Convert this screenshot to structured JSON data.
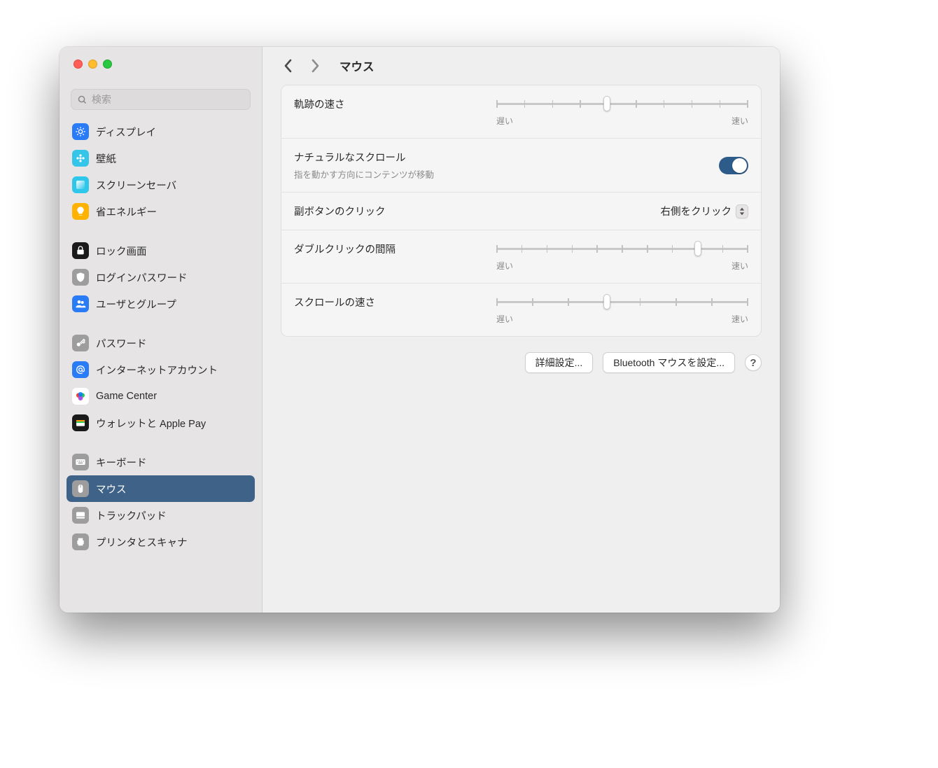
{
  "search": {
    "placeholder": "検索"
  },
  "sidebar": {
    "groups": [
      {
        "items": [
          {
            "id": "display",
            "label": "ディスプレイ",
            "icon": "brightness-icon",
            "bg": "#2a7bf6",
            "fg": "#fff"
          },
          {
            "id": "wallpaper",
            "label": "壁紙",
            "icon": "flower-icon",
            "bg": "#35c5e8",
            "fg": "#fff"
          },
          {
            "id": "screensaver",
            "label": "スクリーンセーバ",
            "icon": "gradient-icon",
            "bg": "#2ec7ea",
            "fg": "#fff"
          },
          {
            "id": "energy",
            "label": "省エネルギー",
            "icon": "bulb-icon",
            "bg": "#ffb300",
            "fg": "#fff"
          }
        ]
      },
      {
        "items": [
          {
            "id": "lockscreen",
            "label": "ロック画面",
            "icon": "lock-icon",
            "bg": "#1a1a1a",
            "fg": "#fff"
          },
          {
            "id": "loginpassword",
            "label": "ログインパスワード",
            "icon": "shield-icon",
            "bg": "#9d9d9d",
            "fg": "#fff"
          },
          {
            "id": "users",
            "label": "ユーザとグループ",
            "icon": "users-icon",
            "bg": "#2a7bf6",
            "fg": "#fff"
          }
        ]
      },
      {
        "items": [
          {
            "id": "passwords",
            "label": "パスワード",
            "icon": "key-icon",
            "bg": "#9d9d9d",
            "fg": "#fff"
          },
          {
            "id": "internet-accounts",
            "label": "インターネットアカウント",
            "icon": "at-icon",
            "bg": "#2a7bf6",
            "fg": "#fff"
          },
          {
            "id": "gamecenter",
            "label": "Game Center",
            "icon": "gamecenter-icon",
            "bg": "#ffffff",
            "fg": "#000"
          },
          {
            "id": "wallet",
            "label": "ウォレットと Apple Pay",
            "icon": "wallet-icon",
            "bg": "#1a1a1a",
            "fg": "#fff"
          }
        ]
      },
      {
        "items": [
          {
            "id": "keyboard",
            "label": "キーボード",
            "icon": "keyboard-icon",
            "bg": "#9d9d9d",
            "fg": "#fff"
          },
          {
            "id": "mouse",
            "label": "マウス",
            "icon": "mouse-icon",
            "bg": "#9d9d9d",
            "fg": "#fff",
            "selected": true
          },
          {
            "id": "trackpad",
            "label": "トラックパッド",
            "icon": "trackpad-icon",
            "bg": "#9d9d9d",
            "fg": "#fff"
          },
          {
            "id": "printers",
            "label": "プリンタとスキャナ",
            "icon": "printer-icon",
            "bg": "#9d9d9d",
            "fg": "#fff"
          }
        ]
      }
    ]
  },
  "header": {
    "title": "マウス"
  },
  "settings": {
    "tracking": {
      "label": "軌跡の速さ",
      "min_label": "遅い",
      "max_label": "速い",
      "ticks": 10,
      "value_pct": 44
    },
    "natural_scroll": {
      "label": "ナチュラルなスクロール",
      "sublabel": "指を動かす方向にコンテンツが移動",
      "on": true
    },
    "secondary_click": {
      "label": "副ボタンのクリック",
      "value": "右側をクリック"
    },
    "double_click": {
      "label": "ダブルクリックの間隔",
      "min_label": "遅い",
      "max_label": "速い",
      "ticks": 11,
      "value_pct": 80
    },
    "scroll_speed": {
      "label": "スクロールの速さ",
      "min_label": "遅い",
      "max_label": "速い",
      "ticks": 8,
      "value_pct": 44
    }
  },
  "footer": {
    "advanced": "詳細設定...",
    "bluetooth": "Bluetooth マウスを設定...",
    "help": "?"
  }
}
